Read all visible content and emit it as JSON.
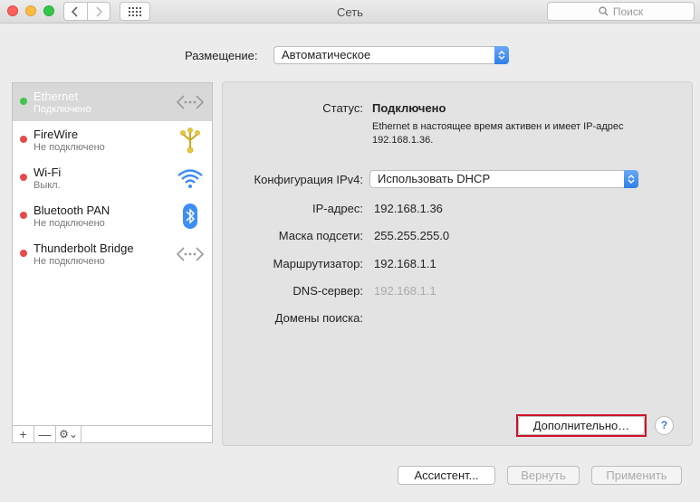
{
  "window": {
    "title": "Сеть",
    "search_placeholder": "Поиск"
  },
  "location": {
    "label": "Размещение:",
    "value": "Автоматическое"
  },
  "services": [
    {
      "name": "Ethernet",
      "status": "Подключено",
      "dot": "green",
      "icon": "ethernet-icon"
    },
    {
      "name": "FireWire",
      "status": "Не подключено",
      "dot": "red",
      "icon": "firewire-icon"
    },
    {
      "name": "Wi-Fi",
      "status": "Выкл.",
      "dot": "red",
      "icon": "wifi-icon"
    },
    {
      "name": "Bluetooth PAN",
      "status": "Не подключено",
      "dot": "red",
      "icon": "bluetooth-icon"
    },
    {
      "name": "Thunderbolt Bridge",
      "status": "Не подключено",
      "dot": "red",
      "icon": "thunderbolt-bridge-icon"
    }
  ],
  "sidebar_toolbar": {
    "add": "+",
    "remove": "—",
    "gear": "⚙︎⌄"
  },
  "detail": {
    "status_label": "Статус:",
    "status_value": "Подключено",
    "status_desc": "Ethernet в настоящее время активен и имеет IP-адрес 192.168.1.36.",
    "ipv4_label": "Конфигурация IPv4:",
    "ipv4_value": "Использовать DHCP",
    "ip_label": "IP-адрес:",
    "ip_value": "192.168.1.36",
    "mask_label": "Маска подсети:",
    "mask_value": "255.255.255.0",
    "router_label": "Маршрутизатор:",
    "router_value": "192.168.1.1",
    "dns_label": "DNS-сервер:",
    "dns_value": "192.168.1.1",
    "domains_label": "Домены поиска:"
  },
  "buttons": {
    "advanced": "Дополнительно…",
    "help": "?",
    "assistant": "Ассистент...",
    "revert": "Вернуть",
    "apply": "Применить"
  },
  "colors": {
    "accent_blue": "#2f7ee8",
    "highlight_red": "#d0102a",
    "status_green": "#3fc64f",
    "status_red": "#e84a4a"
  }
}
